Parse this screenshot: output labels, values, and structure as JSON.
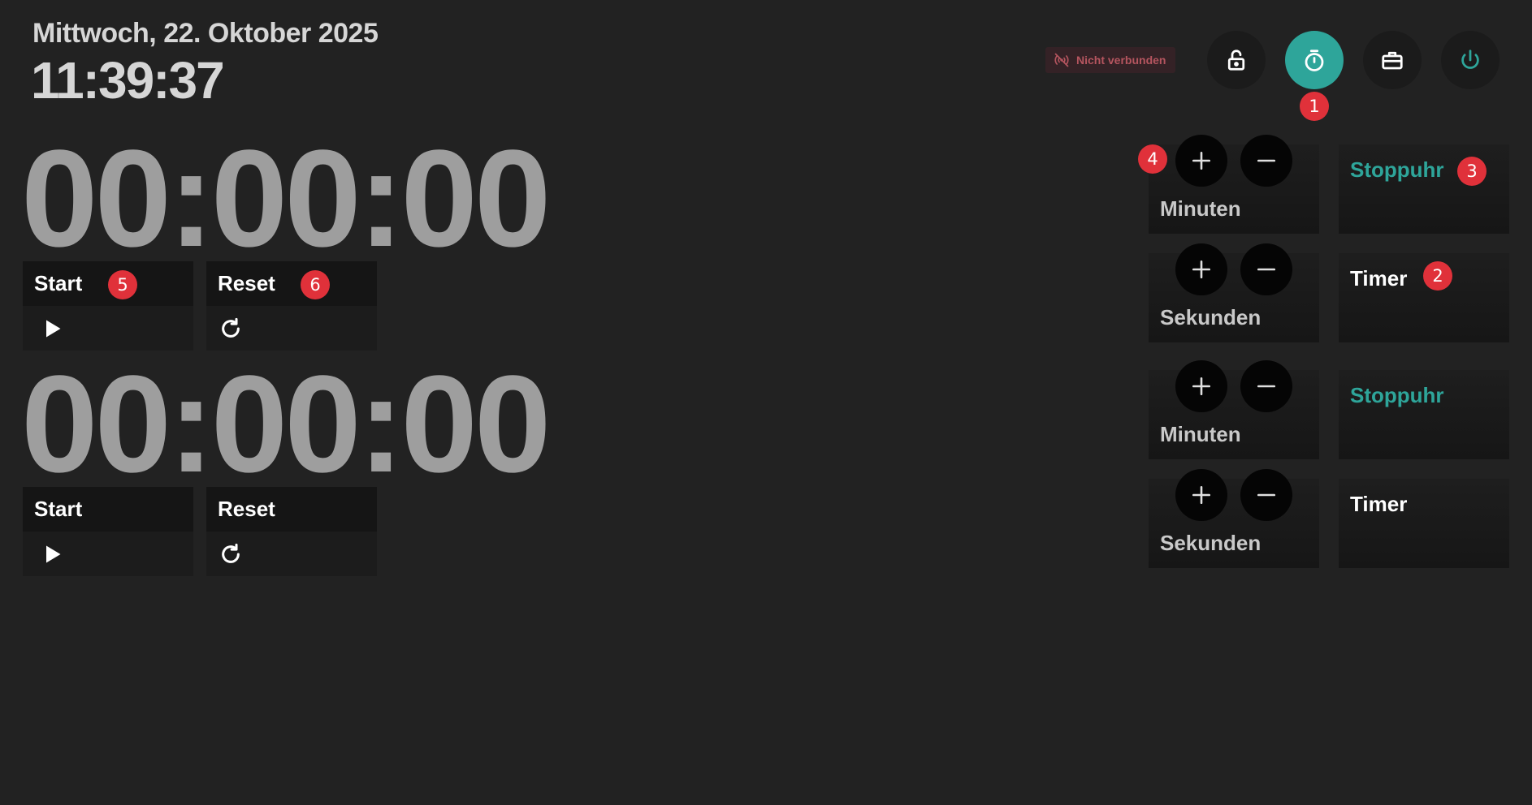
{
  "header": {
    "date": "Mittwoch, 22. Oktober 2025",
    "time": "11:39:37",
    "status_text": "Nicht verbunden",
    "icons": [
      "wifi-off-icon",
      "lock-icon",
      "stopwatch-icon",
      "toolbox-icon",
      "power-icon"
    ]
  },
  "timers": [
    {
      "display": "00:00:00",
      "start_label": "Start",
      "reset_label": "Reset",
      "minutes_label": "Minuten",
      "seconds_label": "Sekunden",
      "stopwatch_label": "Stoppuhr",
      "timer_label": "Timer"
    },
    {
      "display": "00:00:00",
      "start_label": "Start",
      "reset_label": "Reset",
      "minutes_label": "Minuten",
      "seconds_label": "Sekunden",
      "stopwatch_label": "Stoppuhr",
      "timer_label": "Timer"
    }
  ],
  "badges": [
    "1",
    "2",
    "3",
    "4",
    "5",
    "6"
  ],
  "colors": {
    "accent": "#2ea59a",
    "background": "#222222",
    "badge": "#e0313a",
    "status_text": "#b5555f"
  }
}
